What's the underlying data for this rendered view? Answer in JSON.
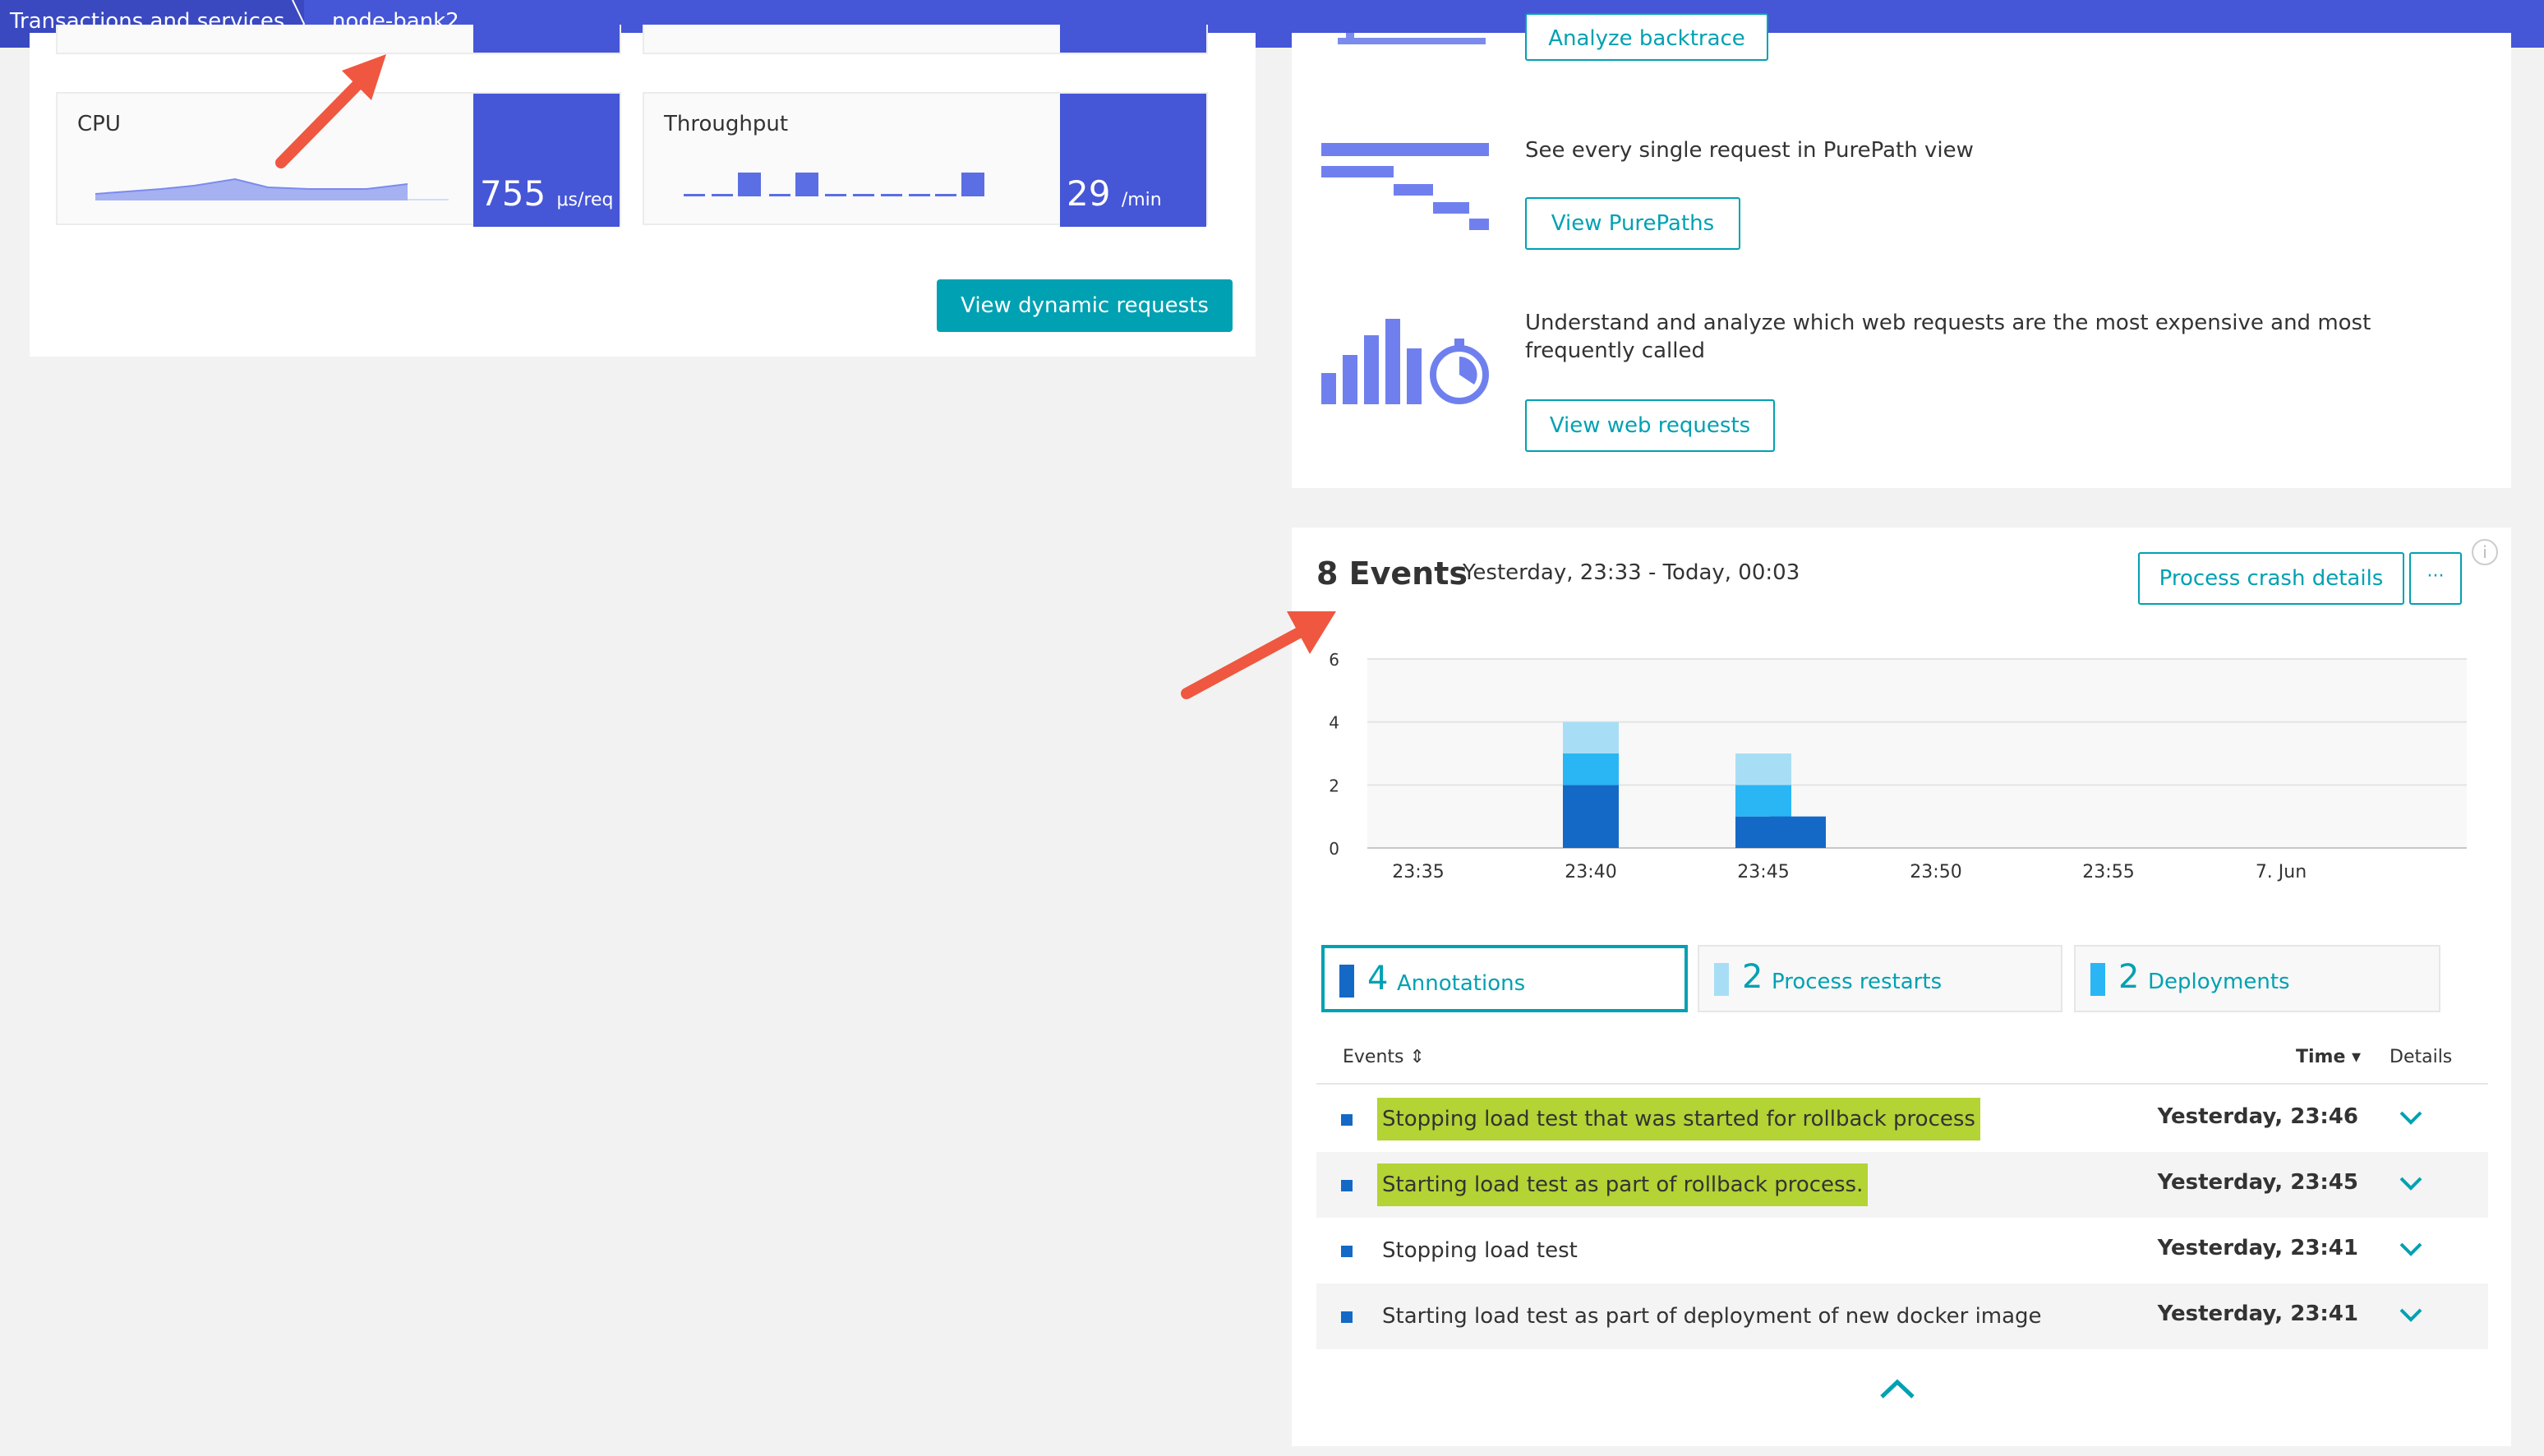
{
  "breadcrumb": {
    "first": "Transactions and services",
    "second": "node-bank2"
  },
  "metrics": {
    "cpu": {
      "label": "CPU",
      "value": "755",
      "unit": "μs/req"
    },
    "throughput": {
      "label": "Throughput",
      "value": "29",
      "unit": "/min"
    }
  },
  "left_panel": {
    "dynamic_button": "View dynamic requests"
  },
  "analysis": {
    "backtrace_button": "Analyze backtrace",
    "purepath_desc": "See every single request in PurePath view",
    "purepath_button": "View PurePaths",
    "web_desc": "Understand and analyze which web requests are the most expensive and most frequently called",
    "web_button": "View web requests"
  },
  "events": {
    "title": "8 Events",
    "range": "Yesterday, 23:33 - Today, 00:03",
    "crash_button": "Process crash details",
    "more_button": "···",
    "info": "i",
    "legend": [
      {
        "count": "4",
        "label": "Annotations",
        "color": "#1469c7"
      },
      {
        "count": "2",
        "label": "Process restarts",
        "color": "#a8def5"
      },
      {
        "count": "2",
        "label": "Deployments",
        "color": "#2ab6f4"
      }
    ],
    "table": {
      "col_events": "Events ⇕",
      "col_time": "Time ▾",
      "col_details": "Details",
      "rows": [
        {
          "text": "Stopping load test that was started for rollback process",
          "time": "Yesterday, 23:46"
        },
        {
          "text": "Starting load test as part of rollback process.",
          "time": "Yesterday, 23:45"
        },
        {
          "text": "Stopping load test",
          "time": "Yesterday, 23:41"
        },
        {
          "text": "Starting load test as part of deployment of new docker image",
          "time": "Yesterday, 23:41"
        }
      ]
    }
  },
  "chart_data": {
    "type": "bar",
    "stacked": true,
    "categories": [
      "23:40",
      "23:45",
      "23:46"
    ],
    "series": [
      {
        "name": "Annotations",
        "values": [
          2,
          1,
          1
        ],
        "color": "#1469c7"
      },
      {
        "name": "Deployments",
        "values": [
          1,
          1,
          0
        ],
        "color": "#2ab6f4"
      },
      {
        "name": "Process restarts",
        "values": [
          1,
          1,
          0
        ],
        "color": "#a8def5"
      }
    ],
    "x_ticks": [
      "23:35",
      "23:40",
      "23:45",
      "23:50",
      "23:55",
      "7. Jun"
    ],
    "y_ticks": [
      "0",
      "2",
      "4",
      "6"
    ],
    "ylim": [
      0,
      6
    ],
    "grid": true
  }
}
